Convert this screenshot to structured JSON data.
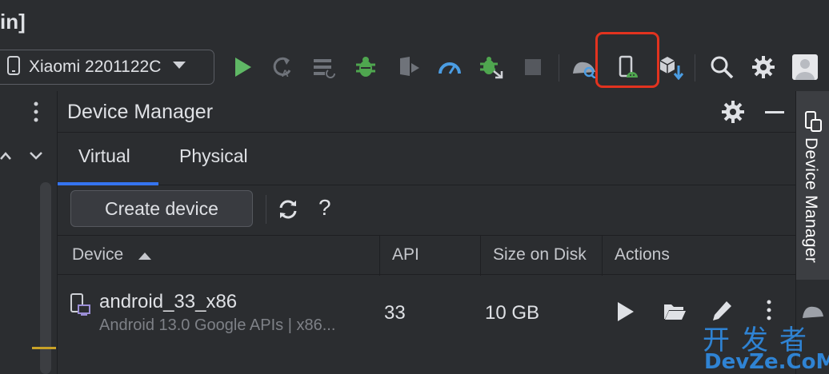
{
  "window": {
    "title": "in]"
  },
  "toolbar": {
    "device_selector": "Xiaomi 2201122C",
    "icons": [
      "run-icon",
      "apply-changes-icon",
      "logcat-icon",
      "debug-icon",
      "coverage-icon",
      "profiler-icon",
      "attach-debugger-icon",
      "stop-icon",
      "layout-inspector-icon",
      "device-manager-icon",
      "sdk-manager-icon",
      "search-icon",
      "gear-icon",
      "avatar"
    ]
  },
  "panel": {
    "title": "Device Manager",
    "tabs": [
      {
        "label": "Virtual",
        "active": true
      },
      {
        "label": "Physical",
        "active": false
      }
    ],
    "create_button": "Create device",
    "help_label": "?",
    "table": {
      "columns": [
        "Device",
        "API",
        "Size on Disk",
        "Actions"
      ],
      "rows": [
        {
          "name": "android_33_x86",
          "description": "Android 13.0 Google APIs | x86...",
          "api": "33",
          "size": "10 GB"
        }
      ]
    }
  },
  "right_strip": {
    "label": "Device Manager"
  },
  "watermark": {
    "line1": "开发者",
    "line2": "DevZe.CoM"
  },
  "colors": {
    "highlight": "#e2331f",
    "run": "#5fb865",
    "debug": "#4fa64f",
    "accent": "#3574f0",
    "profiler": "#4b9de3"
  }
}
